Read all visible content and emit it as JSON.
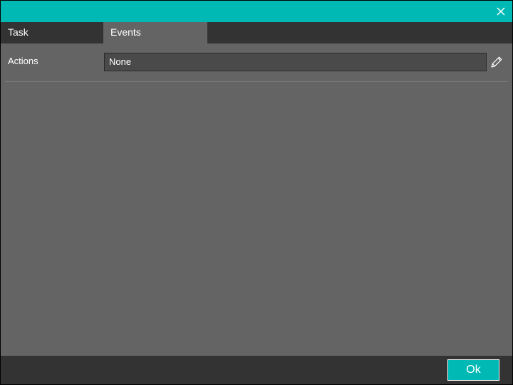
{
  "window": {
    "accent_color": "#00b9b4",
    "close_icon": "close-icon"
  },
  "tabs": [
    {
      "label": "Task",
      "active": false
    },
    {
      "label": "Events",
      "active": true
    }
  ],
  "events": {
    "actions_label": "Actions",
    "actions_value": "None",
    "edit_icon": "pencil-icon"
  },
  "footer": {
    "ok_label": "Ok"
  }
}
